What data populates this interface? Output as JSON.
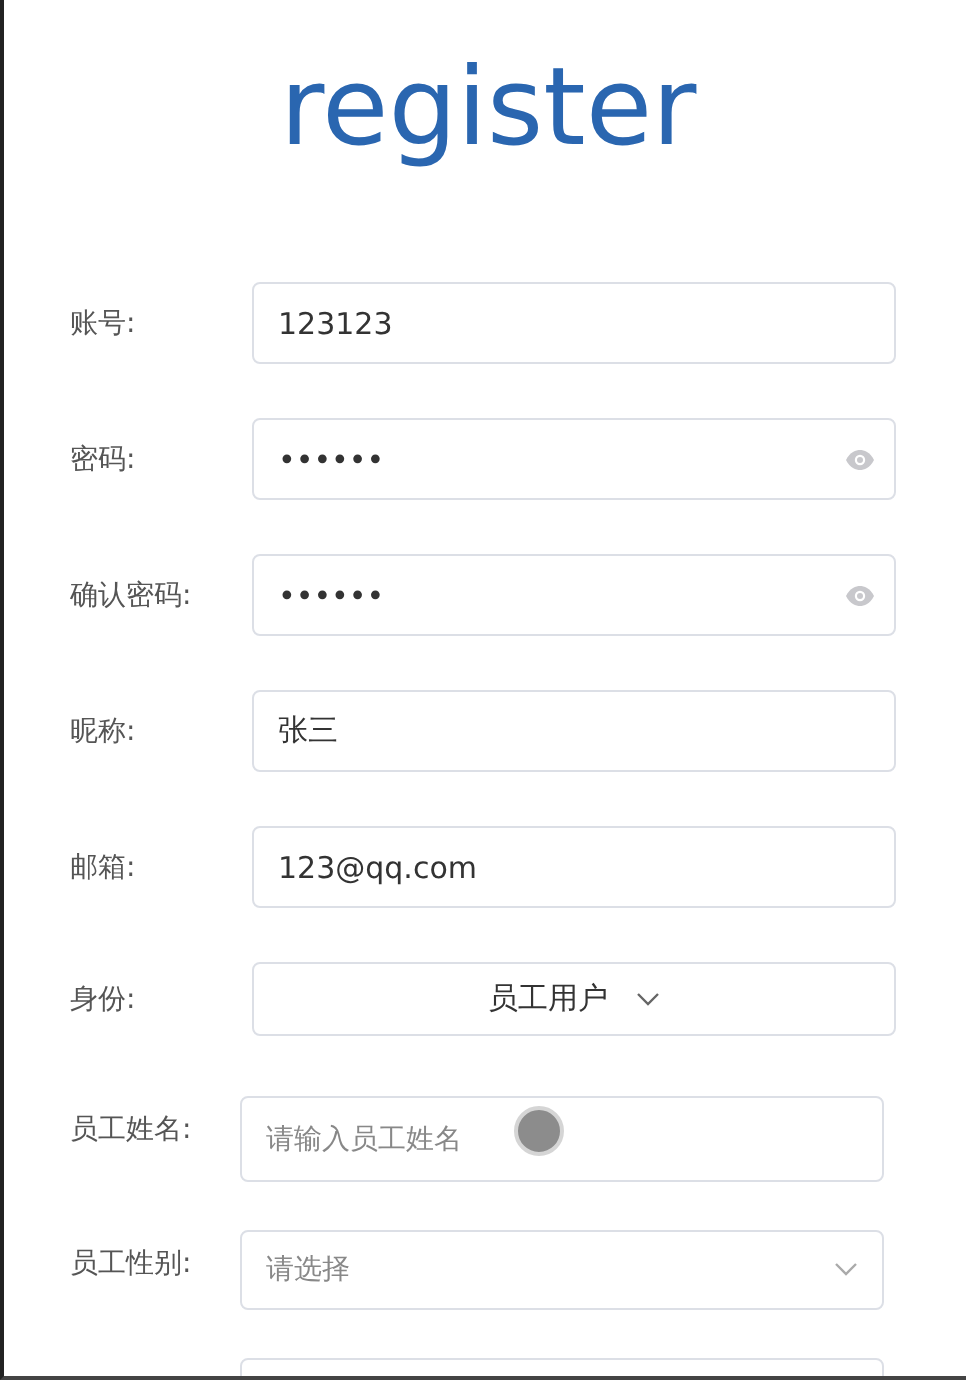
{
  "title": "register",
  "fields": [
    {
      "kind": "text",
      "label": "账号:",
      "value": "123123"
    },
    {
      "kind": "password",
      "label": "密码:",
      "value": "••••••"
    },
    {
      "kind": "password",
      "label": "确认密码:",
      "value": "••••••"
    },
    {
      "kind": "text",
      "label": "昵称:",
      "value": "张三"
    },
    {
      "kind": "text",
      "label": "邮箱:",
      "value": "123@qq.com"
    },
    {
      "kind": "dropdown",
      "label": "身份:",
      "value": "员工用户"
    }
  ],
  "employee_fields": [
    {
      "kind": "text",
      "label": "员工姓名:",
      "placeholder": "请输入员工姓名"
    },
    {
      "kind": "select",
      "label": "员工性别:",
      "placeholder": "请选择"
    },
    {
      "kind": "text"
    }
  ]
}
